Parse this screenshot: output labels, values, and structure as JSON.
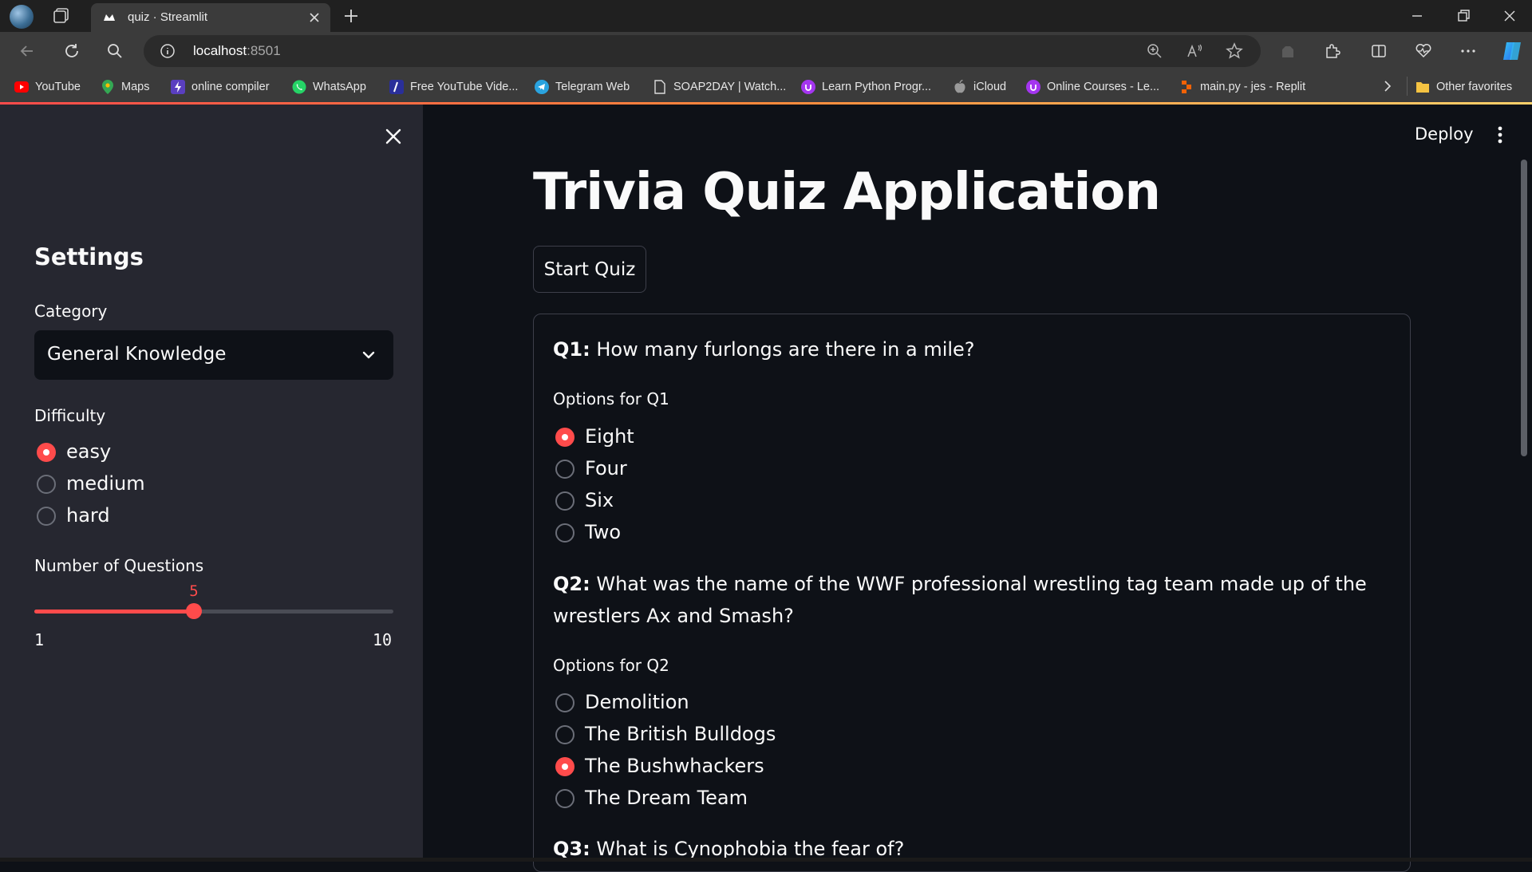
{
  "browser": {
    "tab_title": "quiz · Streamlit",
    "url_host": "localhost",
    "url_port": ":8501",
    "bookmarks": [
      {
        "label": "YouTube",
        "icon": "youtube-icon"
      },
      {
        "label": "Maps",
        "icon": "maps-icon"
      },
      {
        "label": "online compiler",
        "icon": "compiler-icon"
      },
      {
        "label": "WhatsApp",
        "icon": "whatsapp-icon"
      },
      {
        "label": "Free YouTube Vide...",
        "icon": "video-icon"
      },
      {
        "label": "Telegram Web",
        "icon": "telegram-icon"
      },
      {
        "label": "SOAP2DAY | Watch...",
        "icon": "page-icon"
      },
      {
        "label": "Learn Python Progr...",
        "icon": "udemy-icon"
      },
      {
        "label": "iCloud",
        "icon": "apple-icon"
      },
      {
        "label": "Online Courses - Le...",
        "icon": "udemy-icon"
      },
      {
        "label": "main.py - jes - Replit",
        "icon": "replit-icon"
      }
    ],
    "other_favorites": "Other favorites"
  },
  "sidebar": {
    "title": "Settings",
    "category_label": "Category",
    "category_value": "General Knowledge",
    "difficulty_label": "Difficulty",
    "difficulty_options": [
      "easy",
      "medium",
      "hard"
    ],
    "difficulty_selected": 0,
    "questions_label": "Number of Questions",
    "slider_value": "5",
    "slider_min": "1",
    "slider_max": "10"
  },
  "main": {
    "deploy_label": "Deploy",
    "title": "Trivia Quiz Application",
    "start_button": "Start Quiz",
    "questions": [
      {
        "num": "Q1:",
        "text": "How many furlongs are there in a mile?",
        "options_label": "Options for Q1",
        "options": [
          "Eight",
          "Four",
          "Six",
          "Two"
        ],
        "selected": 0
      },
      {
        "num": "Q2:",
        "text": "What was the name of the WWF professional wrestling tag team made up of the wrestlers Ax and Smash?",
        "options_label": "Options for Q2",
        "options": [
          "Demolition",
          "The British Bulldogs",
          "The Bushwhackers",
          "The Dream Team"
        ],
        "selected": 2
      },
      {
        "num": "Q3:",
        "text": "What is Cynophobia the fear of?"
      }
    ]
  },
  "colors": {
    "accent": "#ff4b4b",
    "background": "#0e1117",
    "sidebar": "#262730"
  }
}
